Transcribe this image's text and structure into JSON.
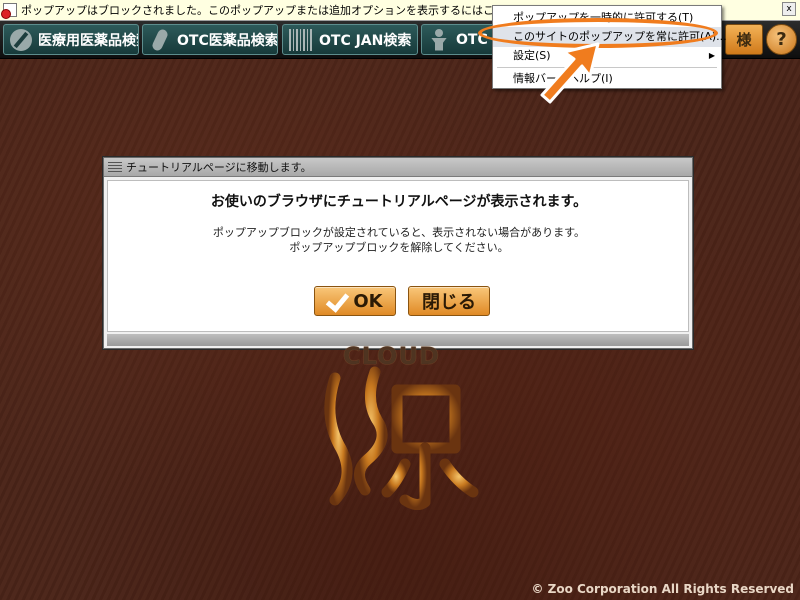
{
  "infobar": {
    "message": "ポップアップはブロックされました。このポップアップまたは追加オプションを表示するにはここをクリックしてくだ",
    "close_label": "x"
  },
  "toolbar": {
    "buttons": [
      {
        "label": "医療用医薬品検索",
        "icon": "slash-circle-icon"
      },
      {
        "label": "OTC医薬品検索",
        "icon": "capsule-icon"
      },
      {
        "label": "OTC JAN検索",
        "icon": "barcode-icon"
      },
      {
        "label": "OTC",
        "icon": "person-icon"
      }
    ],
    "right_button_label": "様",
    "help_label": "?"
  },
  "context_menu": {
    "items": [
      {
        "label": "ポップアップを一時的に許可する(T)"
      },
      {
        "label": "このサイトのポップアップを常に許可(A)..."
      },
      {
        "label": "設定(S)"
      },
      {
        "label": "情報バーのヘルプ(I)"
      }
    ]
  },
  "dialog": {
    "title": "チュートリアルページに移動します。",
    "heading": "お使いのブラウザにチュートリアルページが表示されます。",
    "message_line1": "ポップアップブロックが設定されていると、表示されない場合があります。",
    "message_line2": "ポップアップブロックを解除してください。",
    "ok_label": "OK",
    "close_label": "閉じる"
  },
  "logo": {
    "text": "CLOUD"
  },
  "footer": {
    "copyright": "© Zoo Corporation All Rights Reserved"
  },
  "colors": {
    "highlight_orange": "#f07c1e",
    "toolbar_button": "#2d5a5a",
    "dialog_button": "#f0a040",
    "background": "#4a2418"
  }
}
